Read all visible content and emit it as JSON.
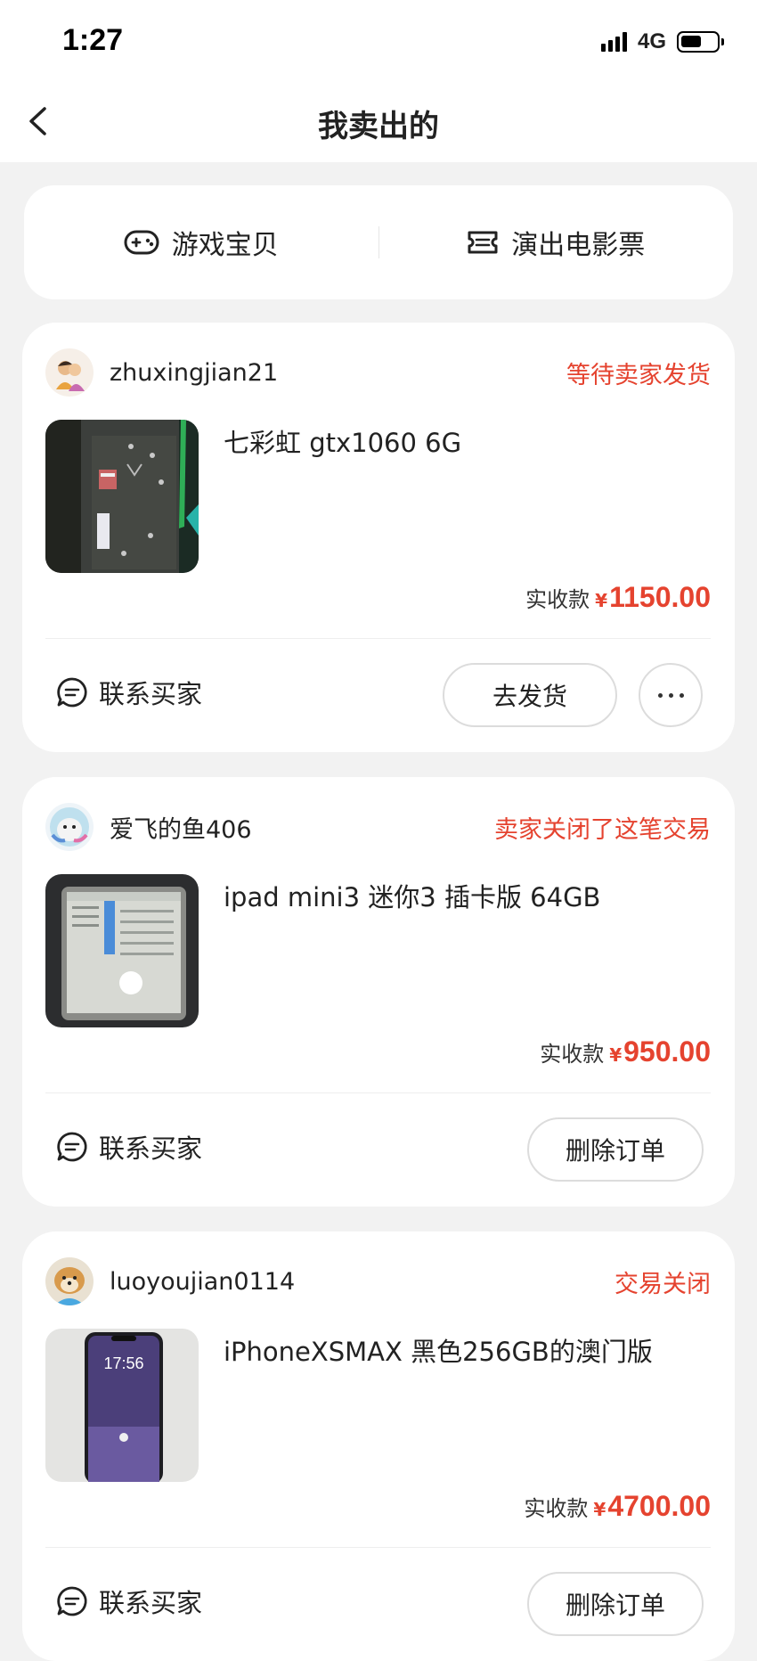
{
  "status_bar": {
    "time": "1:27",
    "network": "4G",
    "battery_level": 0.6
  },
  "nav": {
    "title": "我卖出的",
    "back_icon": "chevron-left-icon"
  },
  "categories": [
    {
      "label": "游戏宝贝",
      "icon": "gamepad-icon"
    },
    {
      "label": "演出电影票",
      "icon": "ticket-icon"
    }
  ],
  "orders": [
    {
      "username": "zhuxingjian21",
      "status": "等待卖家发货",
      "title": "七彩虹 gtx1060 6G",
      "price_label": "实收款",
      "price_currency": "¥",
      "price": "1150.00",
      "contact_label": "联系买家",
      "action_label": "去发货",
      "has_more": true
    },
    {
      "username": "爱飞的鱼406",
      "status": "卖家关闭了这笔交易",
      "title": "ipad mini3 迷你3 插卡版 64GB",
      "price_label": "实收款",
      "price_currency": "¥",
      "price": "950.00",
      "contact_label": "联系买家",
      "action_label": "删除订单",
      "has_more": false
    },
    {
      "username": "luoyoujian0114",
      "status": "交易关闭",
      "title": "iPhoneXSMAX 黑色256GB的澳门版",
      "price_label": "实收款",
      "price_currency": "¥",
      "price": "4700.00",
      "contact_label": "联系买家",
      "action_label": "删除订单",
      "has_more": false,
      "phone_time": "17:56"
    }
  ],
  "colors": {
    "accent": "#e5432f",
    "background": "#f2f2f2",
    "card": "#ffffff"
  }
}
